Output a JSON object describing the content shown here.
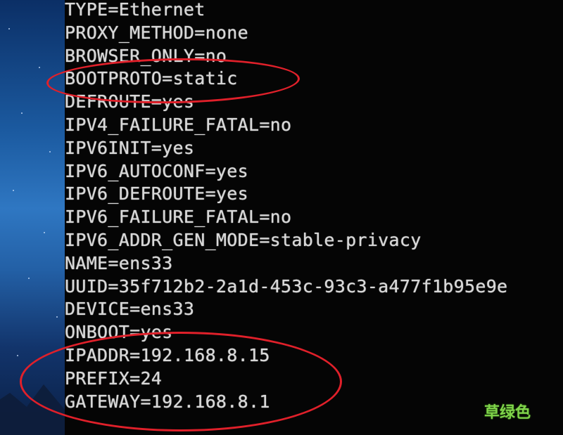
{
  "terminal": {
    "lines": [
      "TYPE=Ethernet",
      "PROXY_METHOD=none",
      "BROWSER_ONLY=no",
      "BOOTPROTO=static",
      "DEFROUTE=yes",
      "IPV4_FAILURE_FATAL=no",
      "IPV6INIT=yes",
      "IPV6_AUTOCONF=yes",
      "IPV6_DEFROUTE=yes",
      "IPV6_FAILURE_FATAL=no",
      "IPV6_ADDR_GEN_MODE=stable-privacy",
      "NAME=ens33",
      "UUID=35f712b2-2a1d-453c-93c3-a477f1b95e9e",
      "DEVICE=ens33",
      "ONBOOT=yes",
      "IPADDR=192.168.8.15",
      "PREFIX=24",
      "GATEWAY=192.168.8.1"
    ]
  },
  "annotations": {
    "color": "#e0202a"
  },
  "watermark": {
    "text": "草绿色",
    "color": "#7fd34a"
  },
  "colors": {
    "terminal_bg": "#050505",
    "terminal_fg": "#d8d8d8"
  }
}
